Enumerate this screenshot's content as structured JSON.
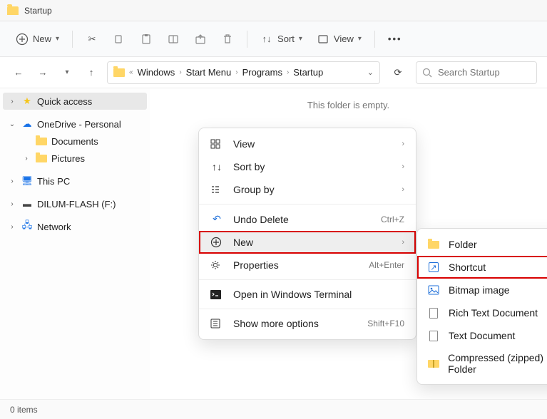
{
  "window": {
    "title": "Startup"
  },
  "toolbar": {
    "new": "New",
    "sort": "Sort",
    "view": "View"
  },
  "breadcrumbs": {
    "prefix": "«",
    "items": [
      "Windows",
      "Start Menu",
      "Programs",
      "Startup"
    ]
  },
  "search": {
    "placeholder": "Search Startup"
  },
  "sidebar": {
    "quick_access": "Quick access",
    "onedrive": "OneDrive - Personal",
    "documents": "Documents",
    "pictures": "Pictures",
    "this_pc": "This PC",
    "drive": "DILUM-FLASH (F:)",
    "network": "Network"
  },
  "main": {
    "empty": "This folder is empty."
  },
  "context_menu": {
    "view": "View",
    "sort_by": "Sort by",
    "group_by": "Group by",
    "undo_delete": "Undo Delete",
    "undo_hint": "Ctrl+Z",
    "new": "New",
    "properties": "Properties",
    "properties_hint": "Alt+Enter",
    "terminal": "Open in Windows Terminal",
    "more": "Show more options",
    "more_hint": "Shift+F10"
  },
  "new_submenu": {
    "folder": "Folder",
    "shortcut": "Shortcut",
    "bitmap": "Bitmap image",
    "rtf": "Rich Text Document",
    "txt": "Text Document",
    "zip": "Compressed (zipped) Folder"
  },
  "status": {
    "items": "0 items"
  }
}
